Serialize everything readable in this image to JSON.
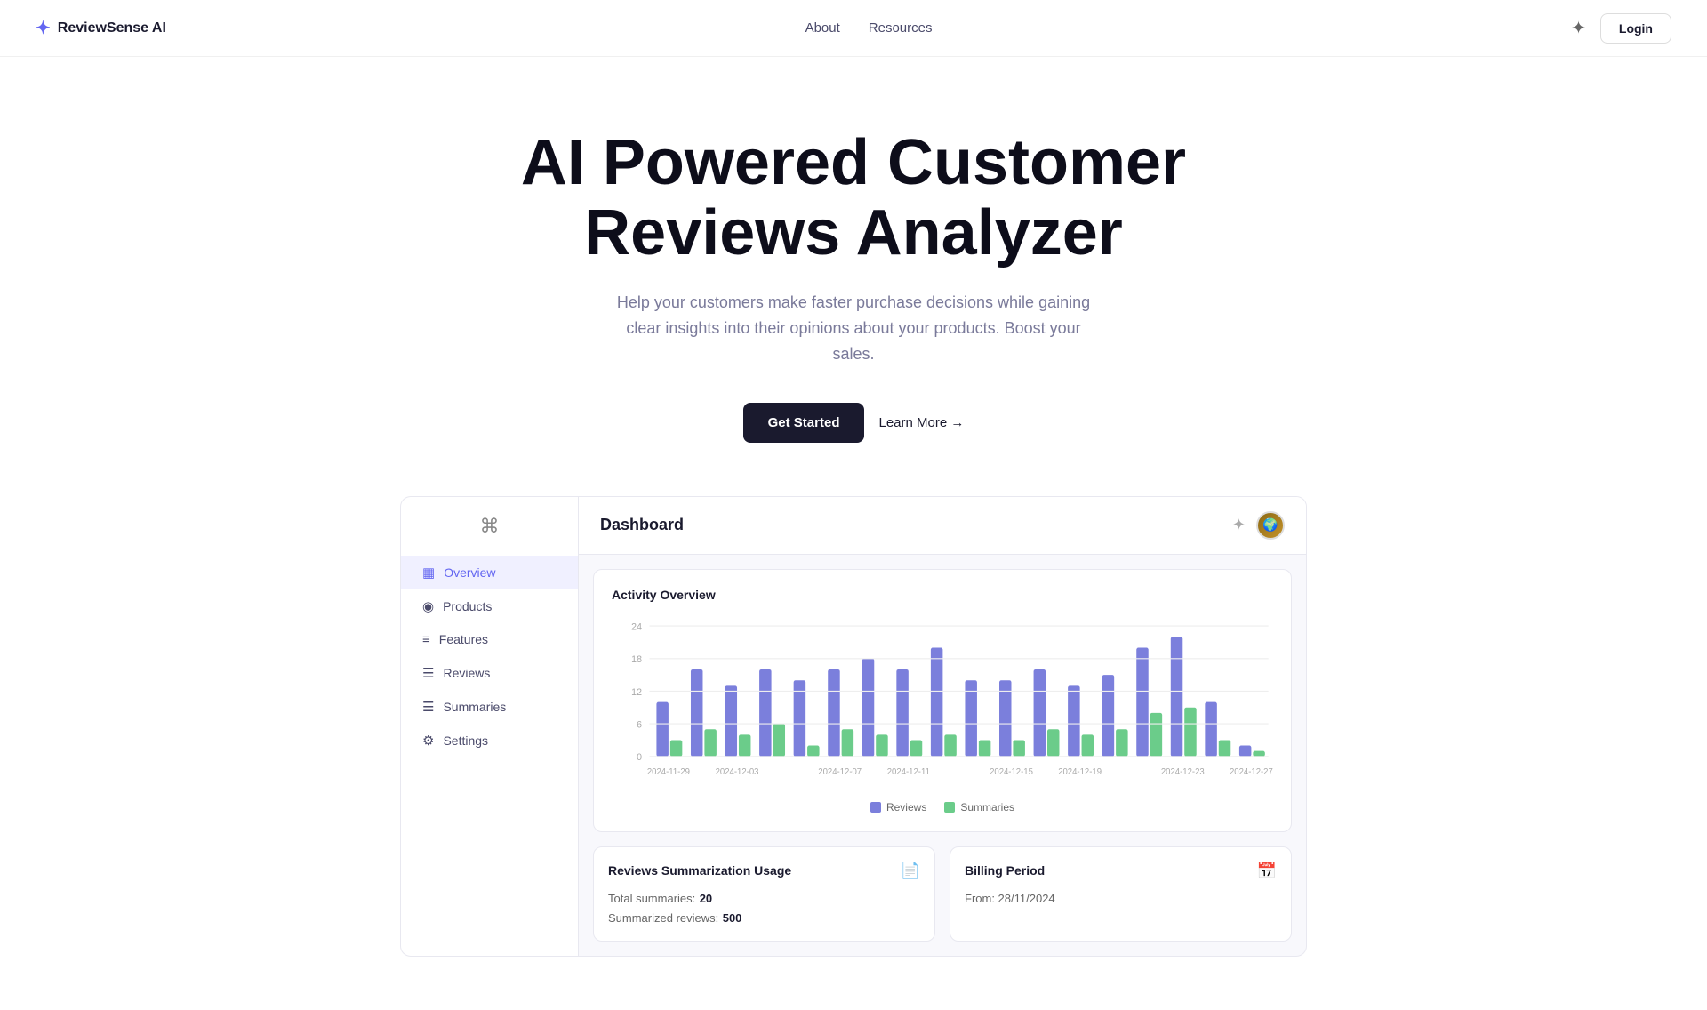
{
  "navbar": {
    "logo_icon": "⌘",
    "logo_text": "ReviewSense AI",
    "nav_items": [
      {
        "label": "About",
        "href": "#"
      },
      {
        "label": "Resources",
        "href": "#"
      }
    ],
    "theme_icon": "✦",
    "login_label": "Login"
  },
  "hero": {
    "title_line1": "AI Powered Customer",
    "title_line2": "Reviews Analyzer",
    "subtitle": "Help your customers make faster purchase decisions while gaining clear insights into their opinions about your products. Boost your sales.",
    "get_started_label": "Get Started",
    "learn_more_label": "Learn More →"
  },
  "sidebar": {
    "logo_icon": "⌘",
    "items": [
      {
        "label": "Overview",
        "icon": "▦",
        "active": true
      },
      {
        "label": "Products",
        "icon": "◉",
        "active": false
      },
      {
        "label": "Features",
        "icon": "≡",
        "active": false
      },
      {
        "label": "Reviews",
        "icon": "☰",
        "active": false
      },
      {
        "label": "Summaries",
        "icon": "☰",
        "active": false
      },
      {
        "label": "Settings",
        "icon": "⚙",
        "active": false
      }
    ]
  },
  "dashboard": {
    "title": "Dashboard",
    "gear_icon": "✦",
    "chart": {
      "title": "Activity Overview",
      "y_labels": [
        "24",
        "18",
        "12",
        "6",
        "0"
      ],
      "x_labels": [
        "2024-11-29",
        "2024-12-03",
        "2024-12-07",
        "2024-12-11",
        "2024-12-15",
        "2024-12-19",
        "2024-12-23",
        "2024-12-27"
      ],
      "legend": [
        {
          "label": "Reviews",
          "color": "#7b7fdc"
        },
        {
          "label": "Summaries",
          "color": "#6bcc8a"
        }
      ],
      "bars": [
        {
          "reviews": 10,
          "summaries": 3
        },
        {
          "reviews": 16,
          "summaries": 5
        },
        {
          "reviews": 13,
          "summaries": 4
        },
        {
          "reviews": 16,
          "summaries": 6
        },
        {
          "reviews": 14,
          "summaries": 2
        },
        {
          "reviews": 16,
          "summaries": 5
        },
        {
          "reviews": 18,
          "summaries": 4
        },
        {
          "reviews": 16,
          "summaries": 3
        },
        {
          "reviews": 20,
          "summaries": 4
        },
        {
          "reviews": 14,
          "summaries": 3
        },
        {
          "reviews": 14,
          "summaries": 3
        },
        {
          "reviews": 16,
          "summaries": 5
        },
        {
          "reviews": 13,
          "summaries": 4
        },
        {
          "reviews": 15,
          "summaries": 5
        },
        {
          "reviews": 20,
          "summaries": 8
        },
        {
          "reviews": 22,
          "summaries": 9
        },
        {
          "reviews": 10,
          "summaries": 3
        },
        {
          "reviews": 2,
          "summaries": 1
        }
      ]
    },
    "usage_card": {
      "title": "Reviews Summarization Usage",
      "icon": "📄",
      "total_summaries_label": "Total summaries:",
      "total_summaries_value": "20",
      "summarized_reviews_label": "Summarized reviews:",
      "summarized_reviews_value": "500"
    },
    "billing_card": {
      "title": "Billing Period",
      "icon": "📅",
      "from_label": "From: 28/11/2024"
    }
  }
}
